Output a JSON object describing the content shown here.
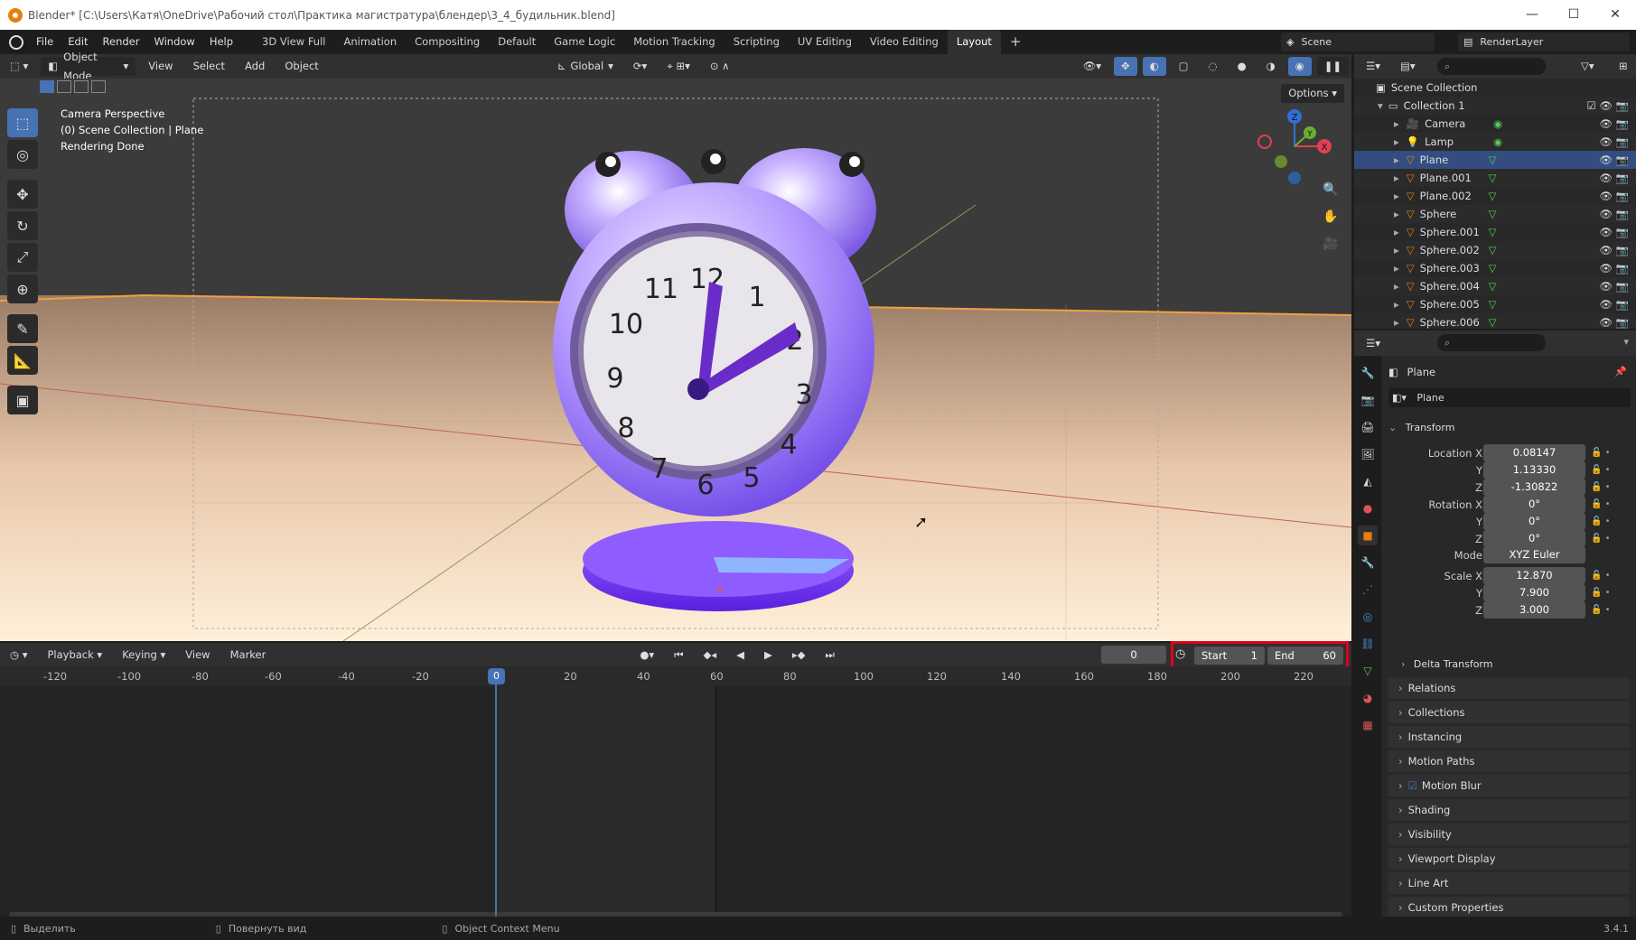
{
  "window": {
    "title": "Blender* [C:\\Users\\Катя\\OneDrive\\Рабочий стол\\Практика магистратура\\блендер\\3_4_будильник.blend]",
    "controls": [
      "—",
      "☐",
      "✕"
    ]
  },
  "menu": [
    "File",
    "Edit",
    "Render",
    "Window",
    "Help"
  ],
  "workspaces": [
    "3D View Full",
    "Animation",
    "Compositing",
    "Default",
    "Game Logic",
    "Motion Tracking",
    "Scripting",
    "UV Editing",
    "Video Editing",
    "Layout"
  ],
  "active_workspace": "Layout",
  "add_workspace": "+",
  "scene": "Scene",
  "view_layer": "RenderLayer",
  "viewport": {
    "mode": "Object Mode",
    "menus": [
      "View",
      "Select",
      "Add",
      "Object"
    ],
    "transform_orientation": "Global",
    "options_label": "Options",
    "info": [
      "Camera Perspective",
      "(0) Scene Collection | Plane",
      "Rendering Done"
    ],
    "gizmo_labels": {
      "x": "X",
      "y": "Y",
      "z": "Z"
    }
  },
  "clock_face": [
    "12",
    "1",
    "2",
    "3",
    "4",
    "5",
    "6",
    "7",
    "8",
    "9",
    "10",
    "11"
  ],
  "timeline": {
    "menus": [
      "Playback",
      "Keying",
      "View",
      "Marker"
    ],
    "current_frame": "0",
    "start_label": "Start",
    "start": "1",
    "end_label": "End",
    "end": "60",
    "ticks": [
      "-120",
      "-100",
      "-80",
      "-60",
      "-40",
      "-20",
      "0",
      "20",
      "40",
      "60",
      "80",
      "100",
      "120",
      "140",
      "160",
      "180",
      "200",
      "220"
    ],
    "playhead": "0"
  },
  "outliner": {
    "root": "Scene Collection",
    "collection": "Collection 1",
    "items": [
      {
        "name": "Camera",
        "type": "camera"
      },
      {
        "name": "Lamp",
        "type": "light"
      },
      {
        "name": "Plane",
        "type": "mesh",
        "selected": true
      },
      {
        "name": "Plane.001",
        "type": "mesh"
      },
      {
        "name": "Plane.002",
        "type": "mesh"
      },
      {
        "name": "Sphere",
        "type": "mesh"
      },
      {
        "name": "Sphere.001",
        "type": "mesh"
      },
      {
        "name": "Sphere.002",
        "type": "mesh"
      },
      {
        "name": "Sphere.003",
        "type": "mesh"
      },
      {
        "name": "Sphere.004",
        "type": "mesh"
      },
      {
        "name": "Sphere.005",
        "type": "mesh"
      },
      {
        "name": "Sphere.006",
        "type": "mesh"
      }
    ]
  },
  "properties": {
    "object_name": "Plane",
    "data_name": "Plane",
    "transform_label": "Transform",
    "location_label": "Location X",
    "rotation_label": "Rotation X",
    "scale_label": "Scale X",
    "y_label": "Y",
    "z_label": "Z",
    "location": [
      "0.08147",
      "1.13330",
      "-1.30822"
    ],
    "rotation": [
      "0°",
      "0°",
      "0°"
    ],
    "mode_label": "Mode",
    "mode": "XYZ Euler",
    "scale": [
      "12.870",
      "7.900",
      "3.000"
    ],
    "delta_transform": "Delta Transform",
    "panels": [
      "Relations",
      "Collections",
      "Instancing",
      "Motion Paths",
      "Motion Blur",
      "Shading",
      "Visibility",
      "Viewport Display",
      "Line Art",
      "Custom Properties"
    ]
  },
  "status": {
    "select": "Выделить",
    "rotate": "Повернуть вид",
    "context": "Object Context Menu",
    "version": "3.4.1"
  },
  "colors": {
    "accent": "#4772b3",
    "highlight_box": "#e0001b",
    "orange": "#e87d0d"
  }
}
